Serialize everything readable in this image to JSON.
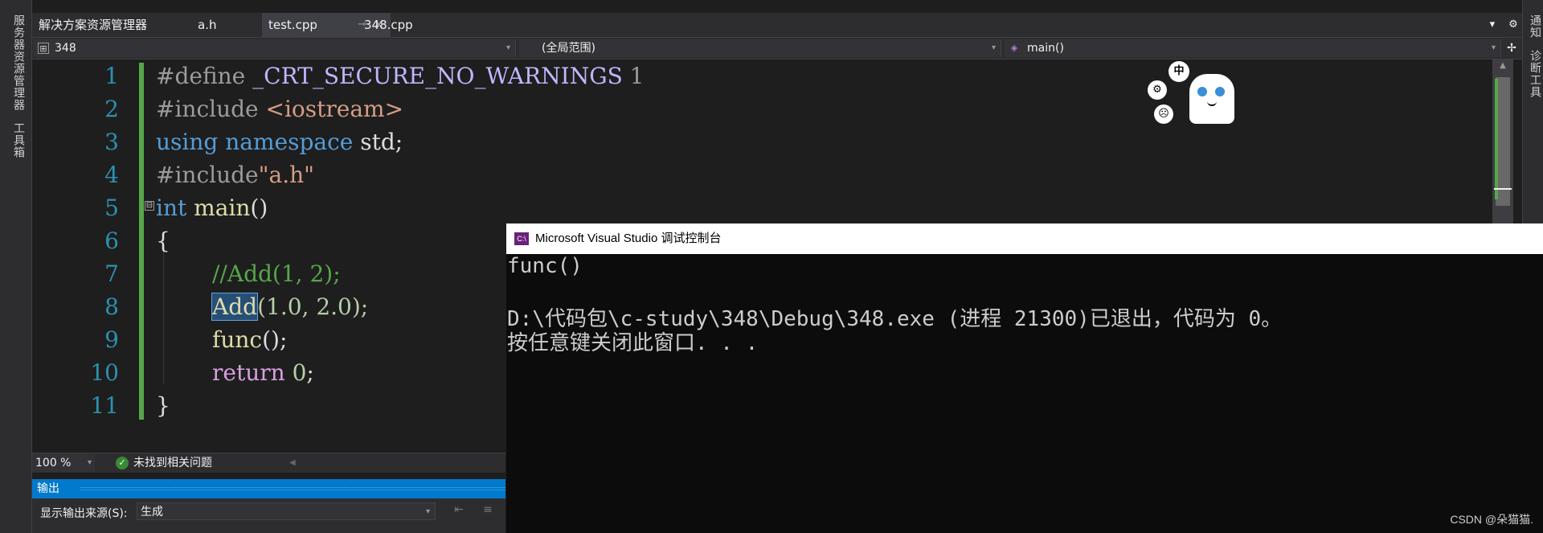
{
  "side_left": {
    "items": [
      "服务器资源管理器",
      "工具箱"
    ]
  },
  "side_right": {
    "items": [
      "通知",
      "诊断工具"
    ]
  },
  "tabs": [
    {
      "label": "解决方案资源管理器"
    },
    {
      "label": "a.h"
    },
    {
      "label": "test.cpp",
      "pin": "⊸",
      "close": "✕"
    },
    {
      "label": "348.cpp"
    }
  ],
  "tabbar_tools": {
    "dropdown": "▾",
    "settings": "⚙"
  },
  "navbar": {
    "project": "348",
    "scope": "(全局范围)",
    "member": "main()",
    "split_icon": "split-icon"
  },
  "editor": {
    "line_numbers": [
      "1",
      "2",
      "3",
      "4",
      "5",
      "6",
      "7",
      "8",
      "9",
      "10",
      "11"
    ],
    "collapse_glyph": "⊟",
    "code": {
      "l1_directive": "#define ",
      "l1_macro": "_CRT_SECURE_NO_WARNINGS",
      "l1_value": " 1",
      "l2_directive": "#include ",
      "l2_header": "<iostream>",
      "l3_using": "using",
      "l3_namespace": " namespace",
      "l3_rest": " std;",
      "l4_directive": "#include",
      "l4_header": "\"a.h\"",
      "l5_type": "int",
      "l5_name": " main",
      "l5_rest": "()",
      "l6": "{",
      "l7_comment": "//Add(1, 2);",
      "l8_call": "Add",
      "l8_args": "(1.0, 2.0);",
      "l9_call": "func",
      "l9_rest": "();",
      "l10_kw": "return",
      "l10_num": " 0",
      "l10_rest": ";",
      "l11": "}"
    }
  },
  "sticker": {
    "bubble_top": "中",
    "bubble_left": "⚙",
    "bubble_bottom": "☹"
  },
  "status": {
    "zoom": "100 %",
    "issues": "未找到相关问题",
    "ok_glyph": "✓"
  },
  "output": {
    "title": "输出",
    "source_label": "显示输出来源(S):",
    "source_value": "生成"
  },
  "console": {
    "icon_text": "C:\\",
    "title": "Microsoft Visual Studio 调试控制台",
    "lines": [
      "func()",
      "",
      "D:\\代码包\\c-study\\348\\Debug\\348.exe (进程 21300)已退出，代码为 0。",
      "按任意键关闭此窗口. . ."
    ],
    "watermark": "CSDN @朵猫猫."
  },
  "colors": {
    "editor_bg": "#1e1e1e",
    "line_numbers": "#2b91af",
    "keyword": "#569cd6",
    "comment": "#57a64a",
    "accent": "#007acc",
    "console_bg": "#0c0c0c"
  }
}
